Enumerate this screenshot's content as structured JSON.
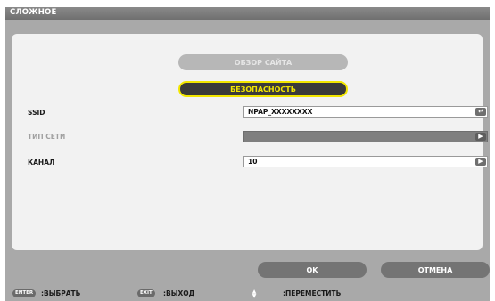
{
  "window": {
    "title": "СЛОЖНОЕ"
  },
  "buttons": {
    "site_survey": "ОБЗОР САЙТА",
    "security": "БЕЗОПАСНОСТЬ",
    "ok": "OK",
    "cancel": "ОТМЕНА"
  },
  "fields": {
    "ssid": {
      "label": "SSID",
      "value": "NPAP_XXXXXXXX",
      "icon": "enter-icon"
    },
    "network_type": {
      "label": "ТИП СЕТИ",
      "value": "",
      "disabled": true,
      "icon": "arrow-right-icon"
    },
    "channel": {
      "label": "КАНАЛ",
      "value": "10",
      "icon": "arrow-right-icon"
    }
  },
  "footer": {
    "enter_key": "ENTER",
    "enter_text": ":ВЫБРАТЬ",
    "exit_key": "EXIT",
    "exit_text": ":ВЫХОД",
    "move_text": ":ПЕРЕМЕСТИТЬ"
  },
  "colors": {
    "highlight": "#f2e600",
    "panel": "#f2f2f2",
    "frame": "#a9a9a9"
  }
}
